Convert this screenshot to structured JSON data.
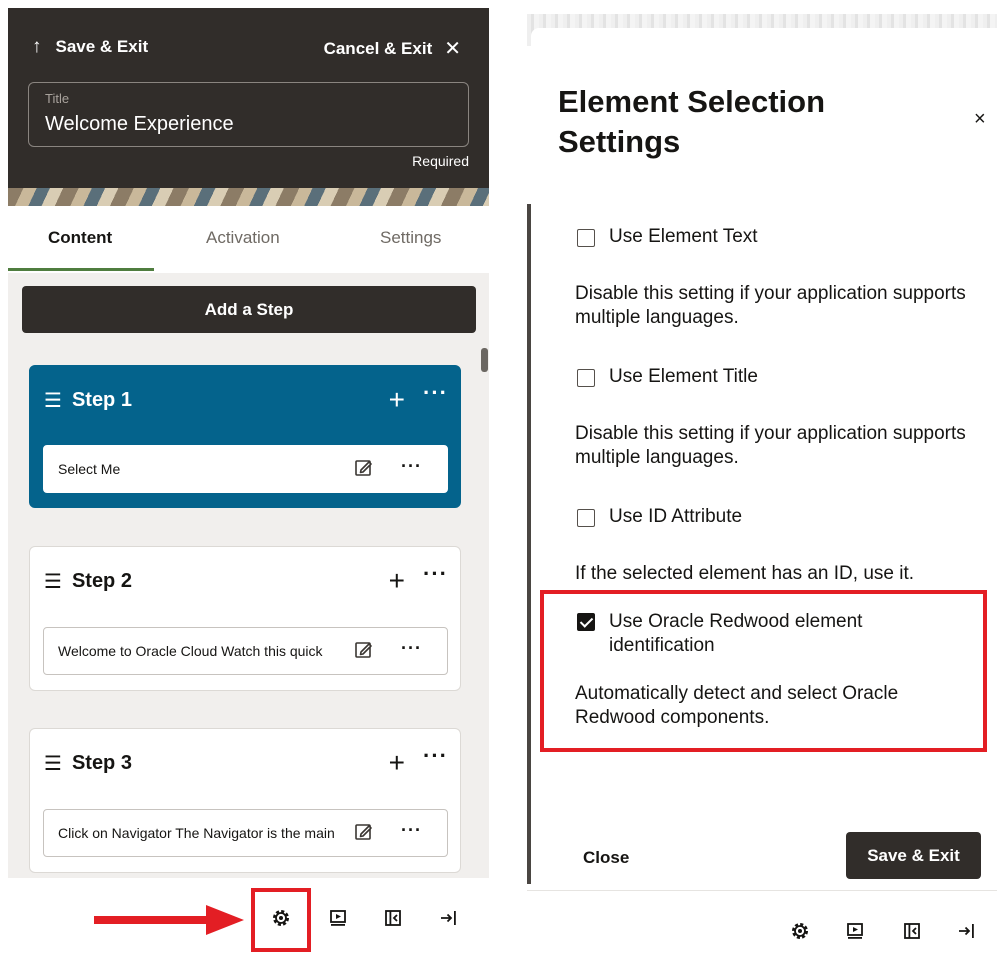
{
  "left": {
    "header": {
      "save_exit_label": "Save & Exit",
      "save_exit_icon": "↑",
      "cancel_exit_label": "Cancel & Exit",
      "cancel_exit_icon": "✕",
      "title_field_label": "Title",
      "title_field_value": "Welcome Experience",
      "required_label": "Required"
    },
    "tabs": [
      {
        "label": "Content",
        "active": true
      },
      {
        "label": "Activation",
        "active": false
      },
      {
        "label": "Settings",
        "active": false
      }
    ],
    "add_step_label": "Add a Step",
    "steps": [
      {
        "title": "Step 1",
        "item_text": "Select Me",
        "active": true
      },
      {
        "title": "Step 2",
        "item_text": "Welcome to Oracle Cloud Watch this quick",
        "active": false
      },
      {
        "title": "Step 3",
        "item_text": "Click on Navigator The Navigator is the main",
        "active": false
      }
    ],
    "footer_icons": [
      "gear-icon",
      "preview-icon",
      "collapse-panel-icon",
      "exit-icon"
    ]
  },
  "right": {
    "dialog_title": "Element Selection Settings",
    "close_icon": "×",
    "options": [
      {
        "label": "Use Element Text",
        "checked": false,
        "description": "Disable this setting if your application supports multiple languages."
      },
      {
        "label": "Use Element Title",
        "checked": false,
        "description": "Disable this setting if your application supports multiple languages."
      },
      {
        "label": "Use ID Attribute",
        "checked": false,
        "description": "If the selected element has an ID, use it."
      },
      {
        "label": "Use Oracle Redwood element identification",
        "checked": true,
        "description": "Automatically detect and select Oracle Redwood components."
      }
    ],
    "close_button_label": "Close",
    "save_exit_button_label": "Save & Exit"
  },
  "colors": {
    "header_dark": "#312d2a",
    "active_step": "#04638c",
    "highlight_red": "#e31e24",
    "tab_underline": "#4f7d3f"
  }
}
